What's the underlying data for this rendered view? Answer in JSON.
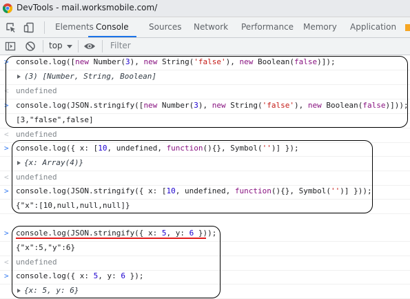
{
  "window": {
    "title": "DevTools - mail.worksmobile.com/"
  },
  "tabs": [
    "Elements",
    "Console",
    "Sources",
    "Network",
    "Performance",
    "Memory",
    "Application"
  ],
  "toolbar": {
    "context": "top",
    "filter_placeholder": "Filter"
  },
  "console": {
    "g1": {
      "in1": {
        "a": "console.log([",
        "b": "new",
        "c": " Number(",
        "d": "3",
        "e": "), ",
        "f": "new",
        "g": " String(",
        "h": "'false'",
        "i": "), ",
        "j": "new",
        "k": " Boolean(",
        "l": "false",
        "m": ")]);"
      },
      "out1": "(3) [Number, String, Boolean]",
      "ret1": "undefined",
      "in2": {
        "a": "console.log(JSON.stringify([",
        "b": "new",
        "c": " Number(",
        "d": "3",
        "e": "), ",
        "f": "new",
        "g": " String(",
        "h": "'false'",
        "i": "), ",
        "j": "new",
        "k": " Boolean(",
        "l": "false",
        "m": ")]));"
      },
      "out2": "[3,\"false\",false]",
      "ret2": "undefined"
    },
    "g2": {
      "in1": {
        "a": "console.log({ x: [",
        "b": "10",
        "c": ", undefined, ",
        "d": "function",
        "e": "(){}, Symbol(",
        "f": "''",
        "g": ")] });"
      },
      "out1": "{x: Array(4)}",
      "ret1": "undefined",
      "in2": {
        "a": "console.log(JSON.stringify({ x: [",
        "b": "10",
        "c": ", undefined, ",
        "d": "function",
        "e": "(){}, Symbol(",
        "f": "''",
        "g": ")] }));"
      },
      "out2": "{\"x\":[10,null,null,null]}"
    },
    "g3": {
      "in1": {
        "a": "console.log(JSON.stringify({ x: ",
        "b": "5",
        "c": ", y: ",
        "d": "6",
        "e": " }));"
      },
      "out1": "{\"x\":5,\"y\":6}",
      "ret1": "undefined",
      "in2": {
        "a": "console.log({ x: ",
        "b": "5",
        "c": ", y: ",
        "d": "6",
        "e": " });"
      },
      "out2": "{x: 5, y: 6}"
    }
  }
}
